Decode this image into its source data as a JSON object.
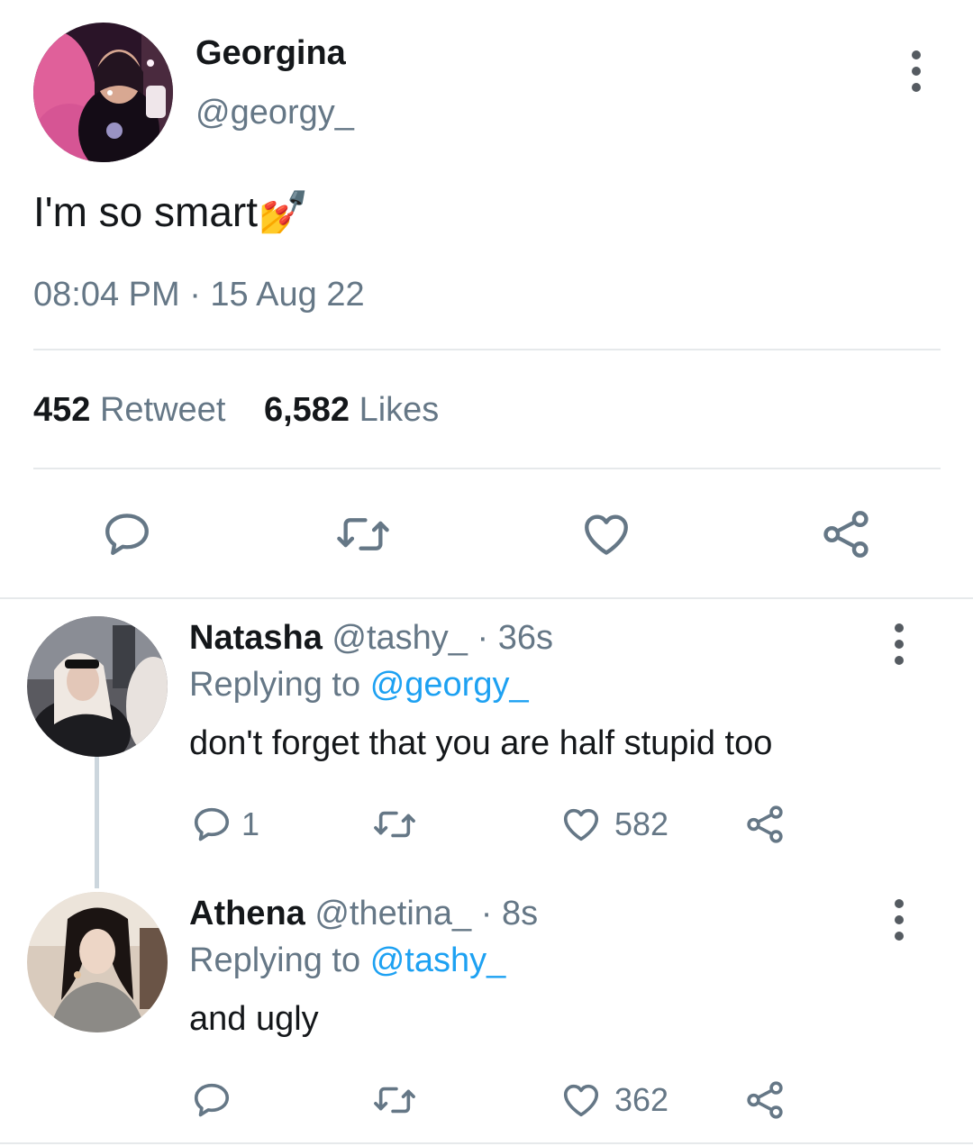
{
  "tweet": {
    "author_name": "Georgina",
    "author_handle": "@georgy_",
    "text": "I'm so smart",
    "emoji": "💅",
    "timestamp": "08:04 PM · 15 Aug 22",
    "retweet_count": "452",
    "retweet_label": "Retweet",
    "likes_count": "6,582",
    "likes_label": "Likes"
  },
  "replies": [
    {
      "name": "Natasha",
      "handle": "@tashy_",
      "time": "· 36s",
      "replying_label": "Replying to",
      "replying_to": "@georgy_",
      "text": "don't forget that you are half stupid too",
      "reply_count": "1",
      "retweet_count": "",
      "like_count": "582"
    },
    {
      "name": "Athena",
      "handle": "@thetina_",
      "time": "· 8s",
      "replying_label": "Replying to",
      "replying_to": "@tashy_",
      "text": "and ugly",
      "reply_count": "",
      "retweet_count": "",
      "like_count": "362"
    }
  ],
  "icons": {
    "reply": "comment-icon",
    "retweet": "retweet-icon",
    "like": "heart-icon",
    "share": "share-icon",
    "more": "more-vertical-icon"
  },
  "colors": {
    "text": "#14171a",
    "secondary": "#657786",
    "accent": "#1da1f2",
    "icon": "#657786"
  }
}
